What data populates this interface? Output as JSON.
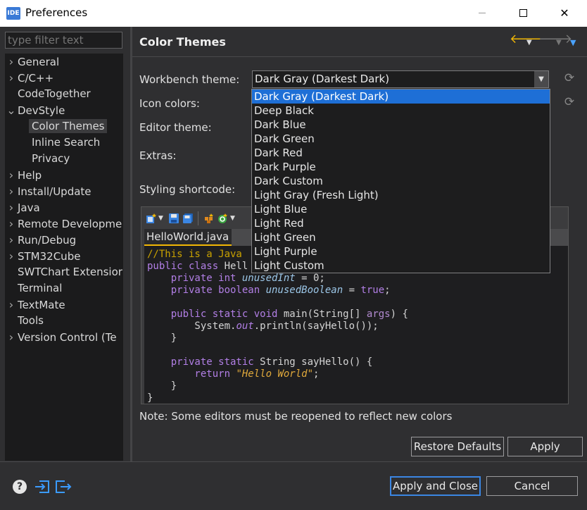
{
  "window": {
    "app_icon_text": "IDE",
    "title": "Preferences"
  },
  "filter": {
    "placeholder": "type filter text"
  },
  "tree": [
    {
      "label": "General",
      "expandable": true,
      "expanded": false,
      "level": 0
    },
    {
      "label": "C/C++",
      "expandable": true,
      "expanded": false,
      "level": 0
    },
    {
      "label": "CodeTogether",
      "expandable": false,
      "level": 0
    },
    {
      "label": "DevStyle",
      "expandable": true,
      "expanded": true,
      "level": 0
    },
    {
      "label": "Color Themes",
      "expandable": false,
      "level": 1,
      "selected": true
    },
    {
      "label": "Inline Search",
      "expandable": false,
      "level": 1
    },
    {
      "label": "Privacy",
      "expandable": false,
      "level": 1
    },
    {
      "label": "Help",
      "expandable": true,
      "expanded": false,
      "level": 0
    },
    {
      "label": "Install/Update",
      "expandable": true,
      "expanded": false,
      "level": 0
    },
    {
      "label": "Java",
      "expandable": true,
      "expanded": false,
      "level": 0
    },
    {
      "label": "Remote Developme",
      "expandable": true,
      "expanded": false,
      "level": 0
    },
    {
      "label": "Run/Debug",
      "expandable": true,
      "expanded": false,
      "level": 0
    },
    {
      "label": "STM32Cube",
      "expandable": true,
      "expanded": false,
      "level": 0
    },
    {
      "label": "SWTChart Extensior",
      "expandable": false,
      "level": 0
    },
    {
      "label": "Terminal",
      "expandable": false,
      "level": 0
    },
    {
      "label": "TextMate",
      "expandable": true,
      "expanded": false,
      "level": 0
    },
    {
      "label": "Tools",
      "expandable": false,
      "level": 0
    },
    {
      "label": "Version Control (Te",
      "expandable": true,
      "expanded": false,
      "level": 0
    }
  ],
  "page": {
    "title": "Color Themes",
    "labels": {
      "workbench": "Workbench theme:",
      "icons": "Icon colors:",
      "editor": "Editor theme:",
      "extras": "Extras:",
      "shortcode": "Styling shortcode:"
    },
    "workbench_value": "Dark Gray (Darkest Dark)",
    "note": "Note: Some editors must be reopened to reflect new colors"
  },
  "dropdown": {
    "options": [
      "Dark Gray (Darkest Dark)",
      "Deep Black",
      "Dark Blue",
      "Dark Green",
      "Dark Red",
      "Dark Purple",
      "Dark Custom",
      "Light Gray (Fresh Light)",
      "Light Blue",
      "Light Red",
      "Light Green",
      "Light Purple",
      "Light Custom"
    ],
    "active": "Dark Gray (Darkest Dark)"
  },
  "preview": {
    "tab": "HelloWorld.java",
    "code": {
      "l1": "//This is a Java",
      "l2a": "public class ",
      "l2b": "Hell",
      "l3a": "    private int ",
      "l3b": "unusedInt",
      "l3c": " = 0;",
      "l4a": "    private boolean ",
      "l4b": "unusedBoolean",
      "l4c": " = ",
      "l4d": "true",
      "l4e": ";",
      "l6a": "    public static void ",
      "l6b": "main(String[] ",
      "l6c": "args",
      "l6d": ") {",
      "l7a": "        System.",
      "l7b": "out",
      "l7c": ".println(sayHello());",
      "l8": "    }",
      "l10a": "    private static ",
      "l10b": "String sayHello() {",
      "l11a": "        return ",
      "l11b": "\"Hello World\"",
      "l11c": ";",
      "l12": "    }",
      "l13": "}"
    }
  },
  "buttons": {
    "restore_defaults": "Restore Defaults",
    "apply": "Apply",
    "apply_and_close": "Apply and Close",
    "cancel": "Cancel"
  },
  "colors": {
    "accent": "#1e6fd6",
    "nav_back": "#f2b705",
    "background": "#2f2f31"
  }
}
